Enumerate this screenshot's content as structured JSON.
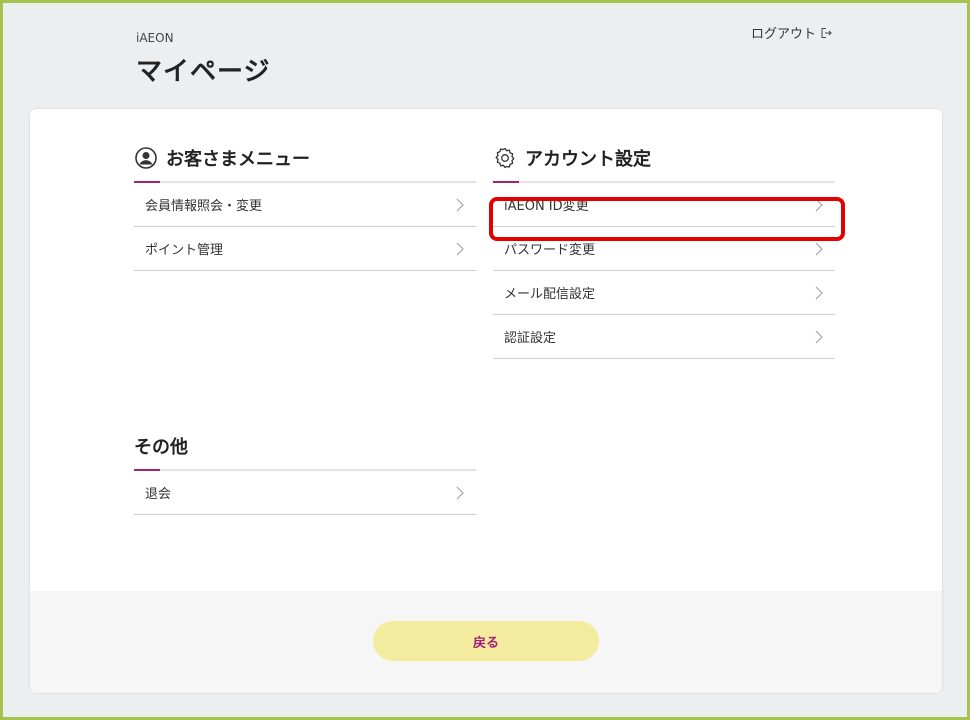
{
  "header": {
    "brand": "iAEON",
    "title": "マイページ",
    "logout_label": "ログアウト"
  },
  "sections": {
    "customer": {
      "title": "お客さまメニュー",
      "items": [
        "会員情報照会・変更",
        "ポイント管理"
      ]
    },
    "account": {
      "title": "アカウント設定",
      "items": [
        "iAEON ID変更",
        "パスワード変更",
        "メール配信設定",
        "認証設定"
      ]
    },
    "other": {
      "title": "その他",
      "items": [
        "退会"
      ]
    }
  },
  "footer": {
    "back_label": "戻る"
  },
  "colors": {
    "accent": "#a0207a",
    "button_bg": "#f3ec9f",
    "highlight": "#e30000",
    "frame": "#a5c34a"
  }
}
